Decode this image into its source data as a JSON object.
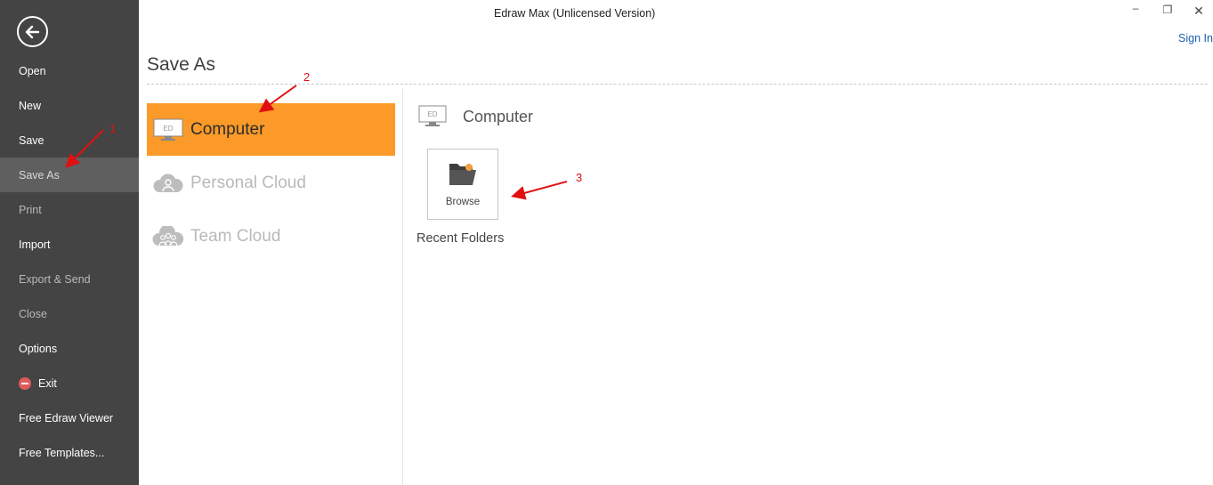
{
  "window": {
    "title": "Edraw Max (Unlicensed Version)",
    "minimize_glyph": "–",
    "restore_glyph": "❐",
    "close_glyph": "✕",
    "sign_in": "Sign In"
  },
  "sidebar": {
    "back_icon": "back-arrow-icon",
    "bg_color": "#444444",
    "items": [
      {
        "label": "Open",
        "state": "normal"
      },
      {
        "label": "New",
        "state": "normal"
      },
      {
        "label": "Save",
        "state": "normal"
      },
      {
        "label": "Save As",
        "state": "active"
      },
      {
        "label": "Print",
        "state": "disabled"
      },
      {
        "label": "Import",
        "state": "normal"
      },
      {
        "label": "Export & Send",
        "state": "disabled"
      },
      {
        "label": "Close",
        "state": "disabled"
      },
      {
        "label": "Options",
        "state": "normal"
      },
      {
        "label": "Exit",
        "state": "normal",
        "icon": "exit-icon"
      },
      {
        "label": "Free Edraw Viewer",
        "state": "normal"
      },
      {
        "label": "Free Templates...",
        "state": "normal"
      }
    ]
  },
  "page": {
    "title": "Save As"
  },
  "locations": {
    "accent_color": "#fb9a28",
    "items": [
      {
        "label": "Computer",
        "icon": "computer-monitor-icon",
        "selected": true
      },
      {
        "label": "Personal Cloud",
        "icon": "personal-cloud-icon",
        "selected": false
      },
      {
        "label": "Team Cloud",
        "icon": "team-cloud-icon",
        "selected": false
      }
    ]
  },
  "right_panel": {
    "heading": "Computer",
    "heading_icon": "computer-monitor-icon",
    "browse_label": "Browse",
    "browse_icon": "folder-icon",
    "recent_folders": "Recent Folders"
  },
  "annotations": {
    "color": "#e01010",
    "labels": [
      "1",
      "2",
      "3"
    ]
  },
  "monitor_badge": "ED"
}
